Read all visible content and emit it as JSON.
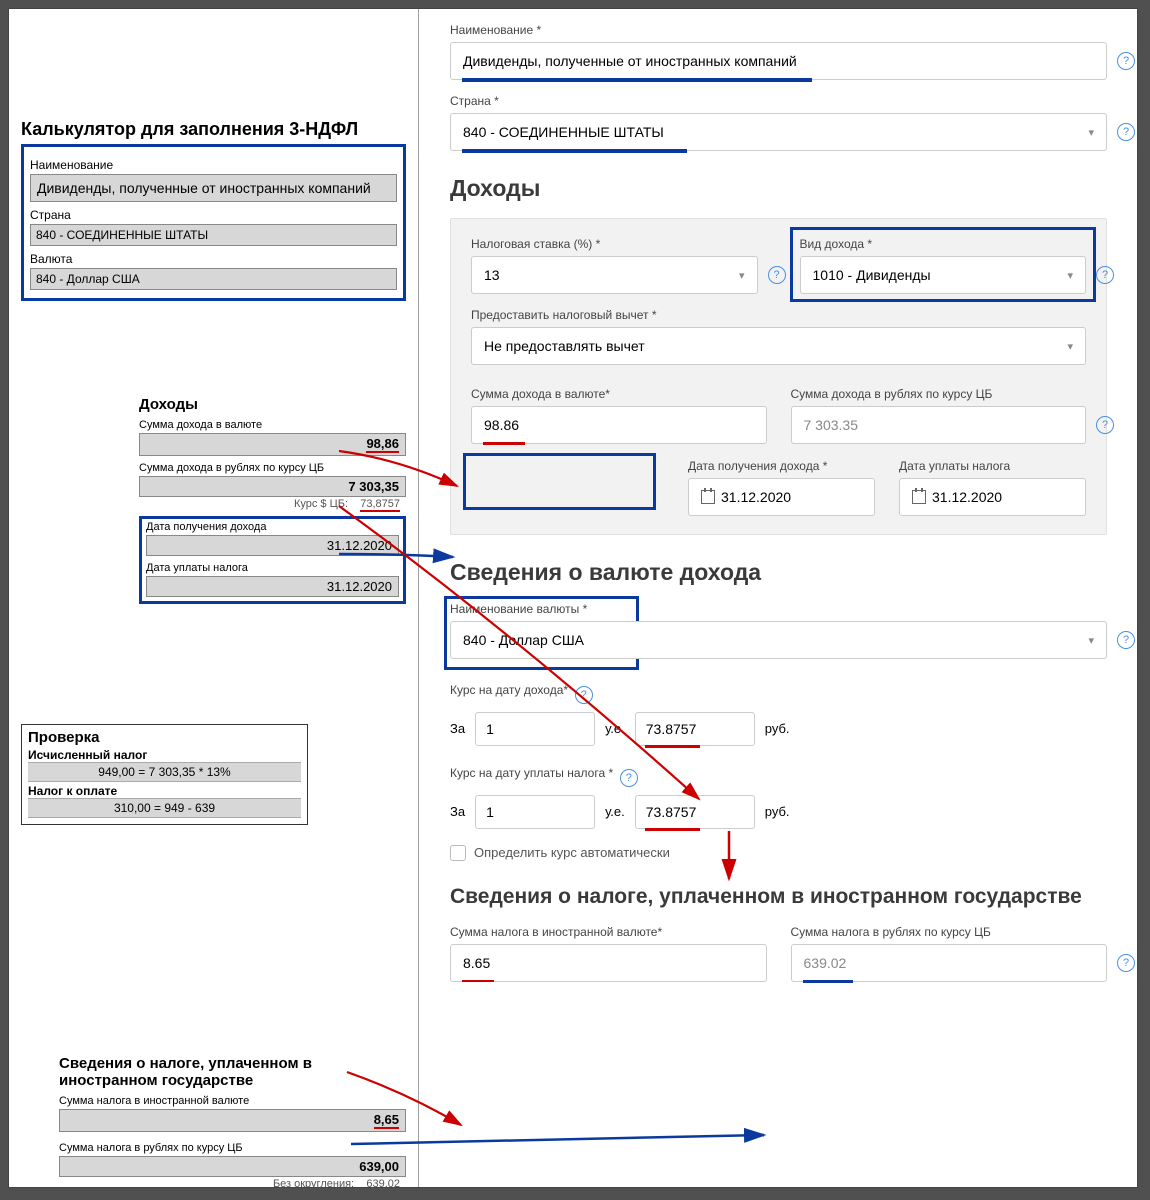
{
  "left": {
    "title": "Калькулятор для заполнения 3-НДФЛ",
    "name_lbl": "Наименование",
    "name_val": "Дивиденды, полученные от иностранных компаний",
    "country_lbl": "Страна",
    "country_val": "840 - СОЕДИНЕННЫЕ ШТАТЫ",
    "currency_lbl": "Валюта",
    "currency_val": "840 - Доллар США",
    "income_hdr": "Доходы",
    "sum_cur_lbl": "Сумма дохода в валюте",
    "sum_cur_val": "98,86",
    "sum_rub_lbl": "Сумма дохода в рублях по курсу ЦБ",
    "sum_rub_val": "7 303,35",
    "rate_lbl": "Курс $ ЦБ:",
    "rate_val": "73,8757",
    "date_income_lbl": "Дата получения дохода",
    "date_income_val": "31.12.2020",
    "date_tax_lbl": "Дата уплаты налога",
    "date_tax_val": "31.12.2020",
    "check_hdr": "Проверка",
    "calc1_lbl": "Исчисленный налог",
    "calc1_val": "949,00  =  7 303,35 * 13%",
    "calc2_lbl": "Налог к оплате",
    "calc2_val": "310,00  =  949 - 639",
    "ft_hdr": "Сведения о налоге, уплаченном в иностранном государстве",
    "ft_cur_lbl": "Сумма налога в иностранной валюте",
    "ft_cur_val": "8,65",
    "ft_rub_lbl": "Сумма налога в рублях по курсу ЦБ",
    "ft_rub_val": "639,00",
    "ft_noround_lbl": "Без округления:",
    "ft_noround_val": "639,02"
  },
  "right": {
    "name_lbl": "Наименование *",
    "name_val": "Дивиденды, полученные от иностранных компаний",
    "country_lbl": "Страна *",
    "country_val": "840 - СОЕДИНЕННЫЕ ШТАТЫ",
    "income_hdr": "Доходы",
    "taxrate_lbl": "Налоговая ставка (%) *",
    "taxrate_val": "13",
    "kind_lbl": "Вид дохода *",
    "kind_val": "1010 - Дивиденды",
    "deduct_lbl": "Предоставить налоговый вычет *",
    "deduct_val": "Не предоставлять вычет",
    "sum_cur_lbl": "Сумма дохода в валюте*",
    "sum_cur_val": "98.86",
    "sum_rub_lbl": "Сумма дохода в рублях по курсу ЦБ",
    "sum_rub_val": "7 303.35",
    "date_income_lbl": "Дата получения дохода *",
    "date_income_val": "31.12.2020",
    "date_tax_lbl": "Дата уплаты налога",
    "date_tax_val": "31.12.2020",
    "cur_info_hdr": "Сведения о валюте дохода",
    "cur_name_lbl": "Наименование валюты *",
    "cur_name_val": "840 - Доллар США",
    "rate_income_lbl": "Курс на дату дохода*",
    "rate_tax_lbl": "Курс на дату уплаты налога *",
    "za": "За",
    "one": "1",
    "ue": "у.е.",
    "rate1": "73.8757",
    "rate2": "73.8757",
    "rub": "руб.",
    "auto_rate": "Определить курс автоматически",
    "ft_hdr": "Сведения о налоге, уплаченном в иностранном государстве",
    "ft_cur_lbl": "Сумма налога в иностранной валюте*",
    "ft_cur_val": "8.65",
    "ft_rub_lbl": "Сумма налога в рублях по курсу ЦБ",
    "ft_rub_val": "639.02"
  }
}
